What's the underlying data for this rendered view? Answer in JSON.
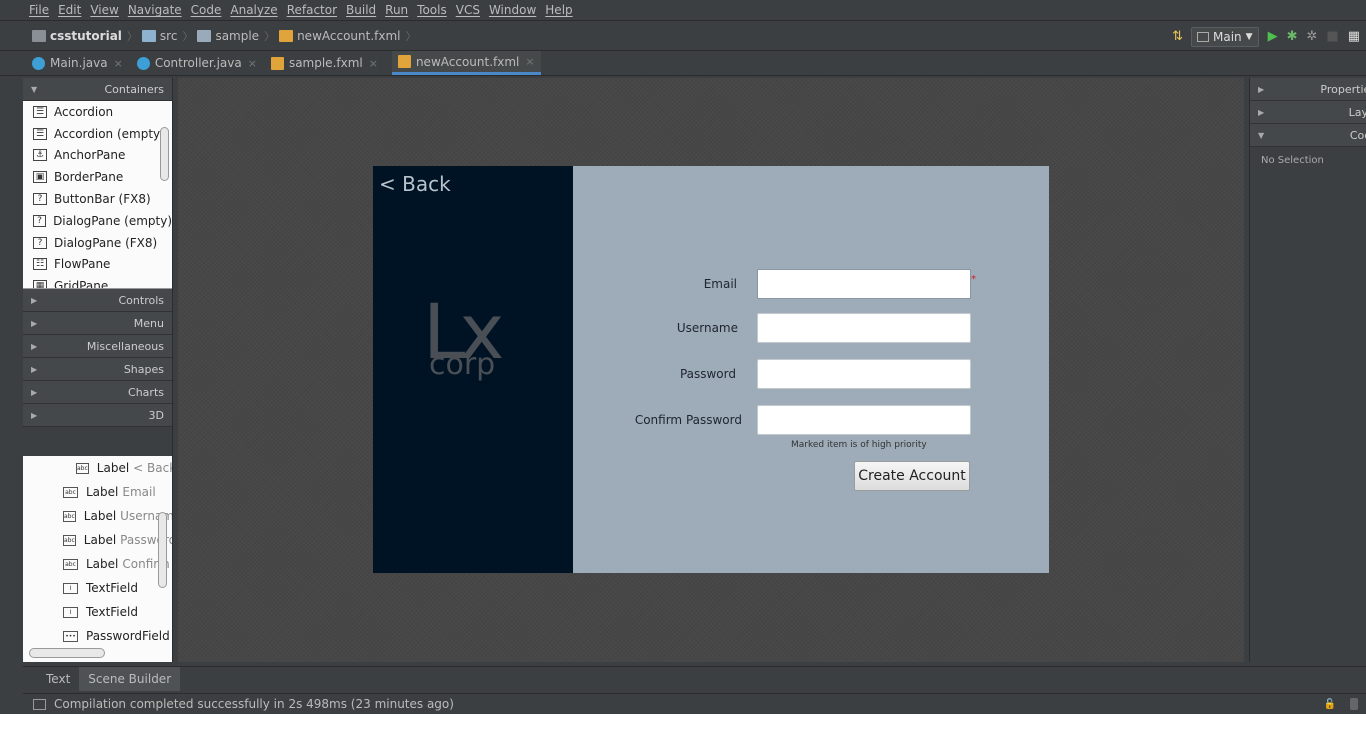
{
  "menubar": [
    "File",
    "Edit",
    "View",
    "Navigate",
    "Code",
    "Analyze",
    "Refactor",
    "Build",
    "Run",
    "Tools",
    "VCS",
    "Window",
    "Help"
  ],
  "breadcrumb": [
    {
      "label": "csstutorial",
      "icon": "project-icon"
    },
    {
      "label": "src",
      "icon": "folder-icon"
    },
    {
      "label": "sample",
      "icon": "package-icon"
    },
    {
      "label": "newAccount.fxml",
      "icon": "fxml-file-icon"
    }
  ],
  "toolbar": {
    "run_config": "Main"
  },
  "tabs": [
    {
      "label": "Main.java",
      "icon": "java-class-icon",
      "active": false
    },
    {
      "label": "Controller.java",
      "icon": "java-class-icon",
      "active": false
    },
    {
      "label": "sample.fxml",
      "icon": "fxml-file-icon",
      "active": false
    },
    {
      "label": "newAccount.fxml",
      "icon": "fxml-file-icon",
      "active": true
    }
  ],
  "library": {
    "containers_title": "Containers",
    "containers": [
      {
        "label": "Accordion"
      },
      {
        "label": "Accordion  (empty)"
      },
      {
        "label": "AnchorPane"
      },
      {
        "label": "BorderPane"
      },
      {
        "label": "ButtonBar  (FX8)"
      },
      {
        "label": "DialogPane (empty)"
      },
      {
        "label": "DialogPane  (FX8)"
      },
      {
        "label": "FlowPane"
      },
      {
        "label": "GridPane"
      }
    ],
    "sections": [
      "Controls",
      "Menu",
      "Miscellaneous",
      "Shapes",
      "Charts",
      "3D"
    ]
  },
  "hierarchy": [
    {
      "type": "Label",
      "text": "< Back"
    },
    {
      "type": "Label",
      "text": "Email"
    },
    {
      "type": "Label",
      "text": "Username"
    },
    {
      "type": "Label",
      "text": "Password"
    },
    {
      "type": "Label",
      "text": "Confirm"
    },
    {
      "type": "TextField",
      "text": ""
    },
    {
      "type": "TextField",
      "text": ""
    },
    {
      "type": "PasswordField",
      "text": ""
    }
  ],
  "form": {
    "back": "< Back",
    "logo_main": "Lx",
    "logo_sub": "corp",
    "email_label": "Email",
    "username_label": "Username",
    "password_label": "Password",
    "confirm_label": "Confirm Password",
    "required_mark": "*",
    "hint": "Marked item is of high priority",
    "create_button": "Create Account"
  },
  "inspector": {
    "sections": [
      "Properties",
      "Layout",
      "Code"
    ],
    "no_selection": "No Selection"
  },
  "bottom_tabs": [
    "Text",
    "Scene Builder"
  ],
  "status": "Compilation completed successfully in 2s 498ms (23 minutes ago)"
}
